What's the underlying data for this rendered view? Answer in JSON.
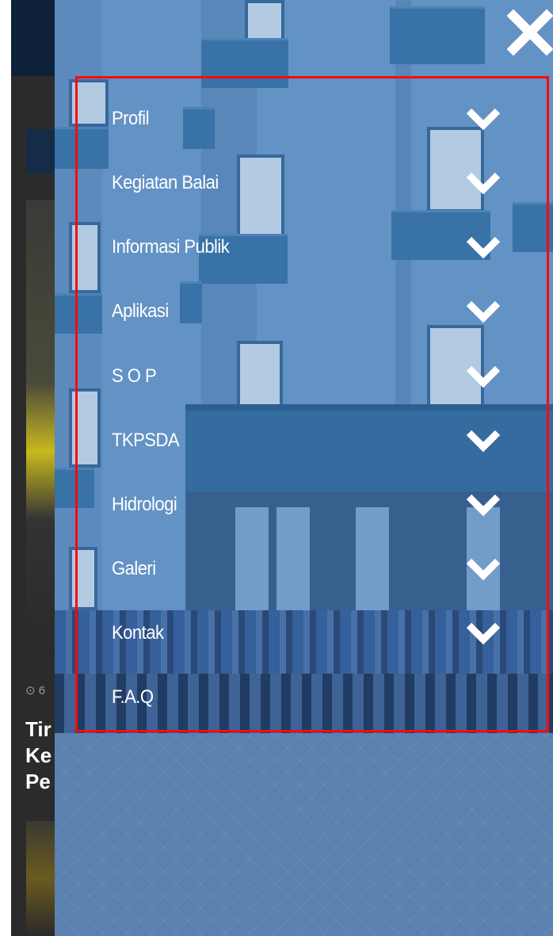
{
  "underlying_page": {
    "meta_text": "⊙ 6",
    "title_lines": [
      "Tir",
      "Ke",
      "Pe"
    ]
  },
  "drawer": {
    "close_icon": "close-icon",
    "menu_items": [
      {
        "label": "Profil",
        "icon": "chevron-down-icon"
      },
      {
        "label": "Kegiatan Balai",
        "icon": "chevron-down-icon"
      },
      {
        "label": "Informasi Publik",
        "icon": "chevron-down-icon"
      },
      {
        "label": "Aplikasi",
        "icon": "chevron-down-icon"
      },
      {
        "label": "S O P",
        "icon": "chevron-down-icon"
      },
      {
        "label": "TKPSDA",
        "icon": "chevron-down-icon"
      },
      {
        "label": "Hidrologi",
        "icon": "chevron-down-icon"
      },
      {
        "label": "Galeri",
        "icon": "chevron-down-icon"
      },
      {
        "label": "Kontak",
        "icon": "chevron-down-icon"
      },
      {
        "label": "F.A.Q",
        "icon": null
      }
    ]
  },
  "colors": {
    "menu_text": "#ffffff",
    "highlight_border": "#ff0a0a",
    "header_bg": "#0d2238"
  }
}
